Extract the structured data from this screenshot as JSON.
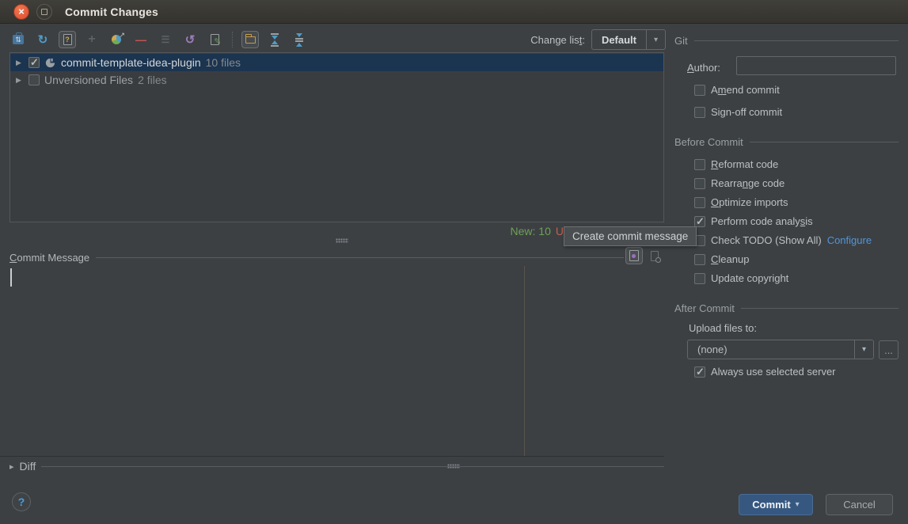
{
  "window": {
    "title": "Commit Changes"
  },
  "icons": {
    "close": "×",
    "diff_arrows": "⇅",
    "refresh": "↻",
    "unversioned_mark": "?",
    "add": "+",
    "move_arrow": "↗",
    "remove": "—",
    "set_active": "☰",
    "rollback": "↺",
    "edit_pencil": "✎",
    "combo_arrow": "▾",
    "tree_arrow": "▶",
    "diff_arrow": "▸",
    "commit_menu_arrow": "▾"
  },
  "toolbar": {
    "changelist_label": [
      "Change lis",
      "t",
      ":"
    ],
    "changelist_value": "Default"
  },
  "changes": {
    "rows": [
      {
        "name": "commit-template-idea-plugin",
        "count": "10 files",
        "checked": true
      },
      {
        "name": "Unversioned Files",
        "count": "2 files",
        "checked": false
      }
    ],
    "legend_new": "New: 10",
    "legend_more": "U"
  },
  "tooltip": {
    "text": "Create commit message"
  },
  "commit_message": {
    "label": [
      "",
      "C",
      "ommit Message"
    ]
  },
  "git": {
    "header": "Git",
    "author_label": [
      "",
      "A",
      "uthor:"
    ],
    "author_value": "",
    "amend": {
      "label": [
        "A",
        "m",
        "end commit"
      ],
      "checked": false
    },
    "signoff": {
      "label": [
        "Sign-off commit",
        "",
        ""
      ],
      "checked": false
    }
  },
  "before_commit": {
    "header": "Before Commit",
    "reformat": {
      "label": [
        "",
        "R",
        "eformat code"
      ],
      "checked": false
    },
    "rearrange": {
      "label": [
        "Rearra",
        "n",
        "ge code"
      ],
      "checked": false
    },
    "optimize": {
      "label": [
        "",
        "O",
        "ptimize imports"
      ],
      "checked": false
    },
    "analysis": {
      "label": [
        "Perform code analy",
        "s",
        "is"
      ],
      "checked": true
    },
    "todo": {
      "label": [
        "Check TODO (Show All)",
        "",
        ""
      ],
      "checked": false,
      "link": "Configure"
    },
    "cleanup": {
      "label": [
        "",
        "C",
        "leanup"
      ],
      "checked": false
    },
    "copyright": {
      "label": [
        "Update copyright",
        "",
        ""
      ],
      "checked": false
    }
  },
  "after_commit": {
    "header": "After Commit",
    "upload_label": "Upload files to:",
    "upload_value": "(none)",
    "browse": "...",
    "always": {
      "label": [
        "Always use selected server",
        "",
        ""
      ],
      "checked": true
    }
  },
  "diff": {
    "label": "Diff"
  },
  "footer": {
    "help": "?",
    "commit": "Commit",
    "cancel": "Cancel"
  }
}
